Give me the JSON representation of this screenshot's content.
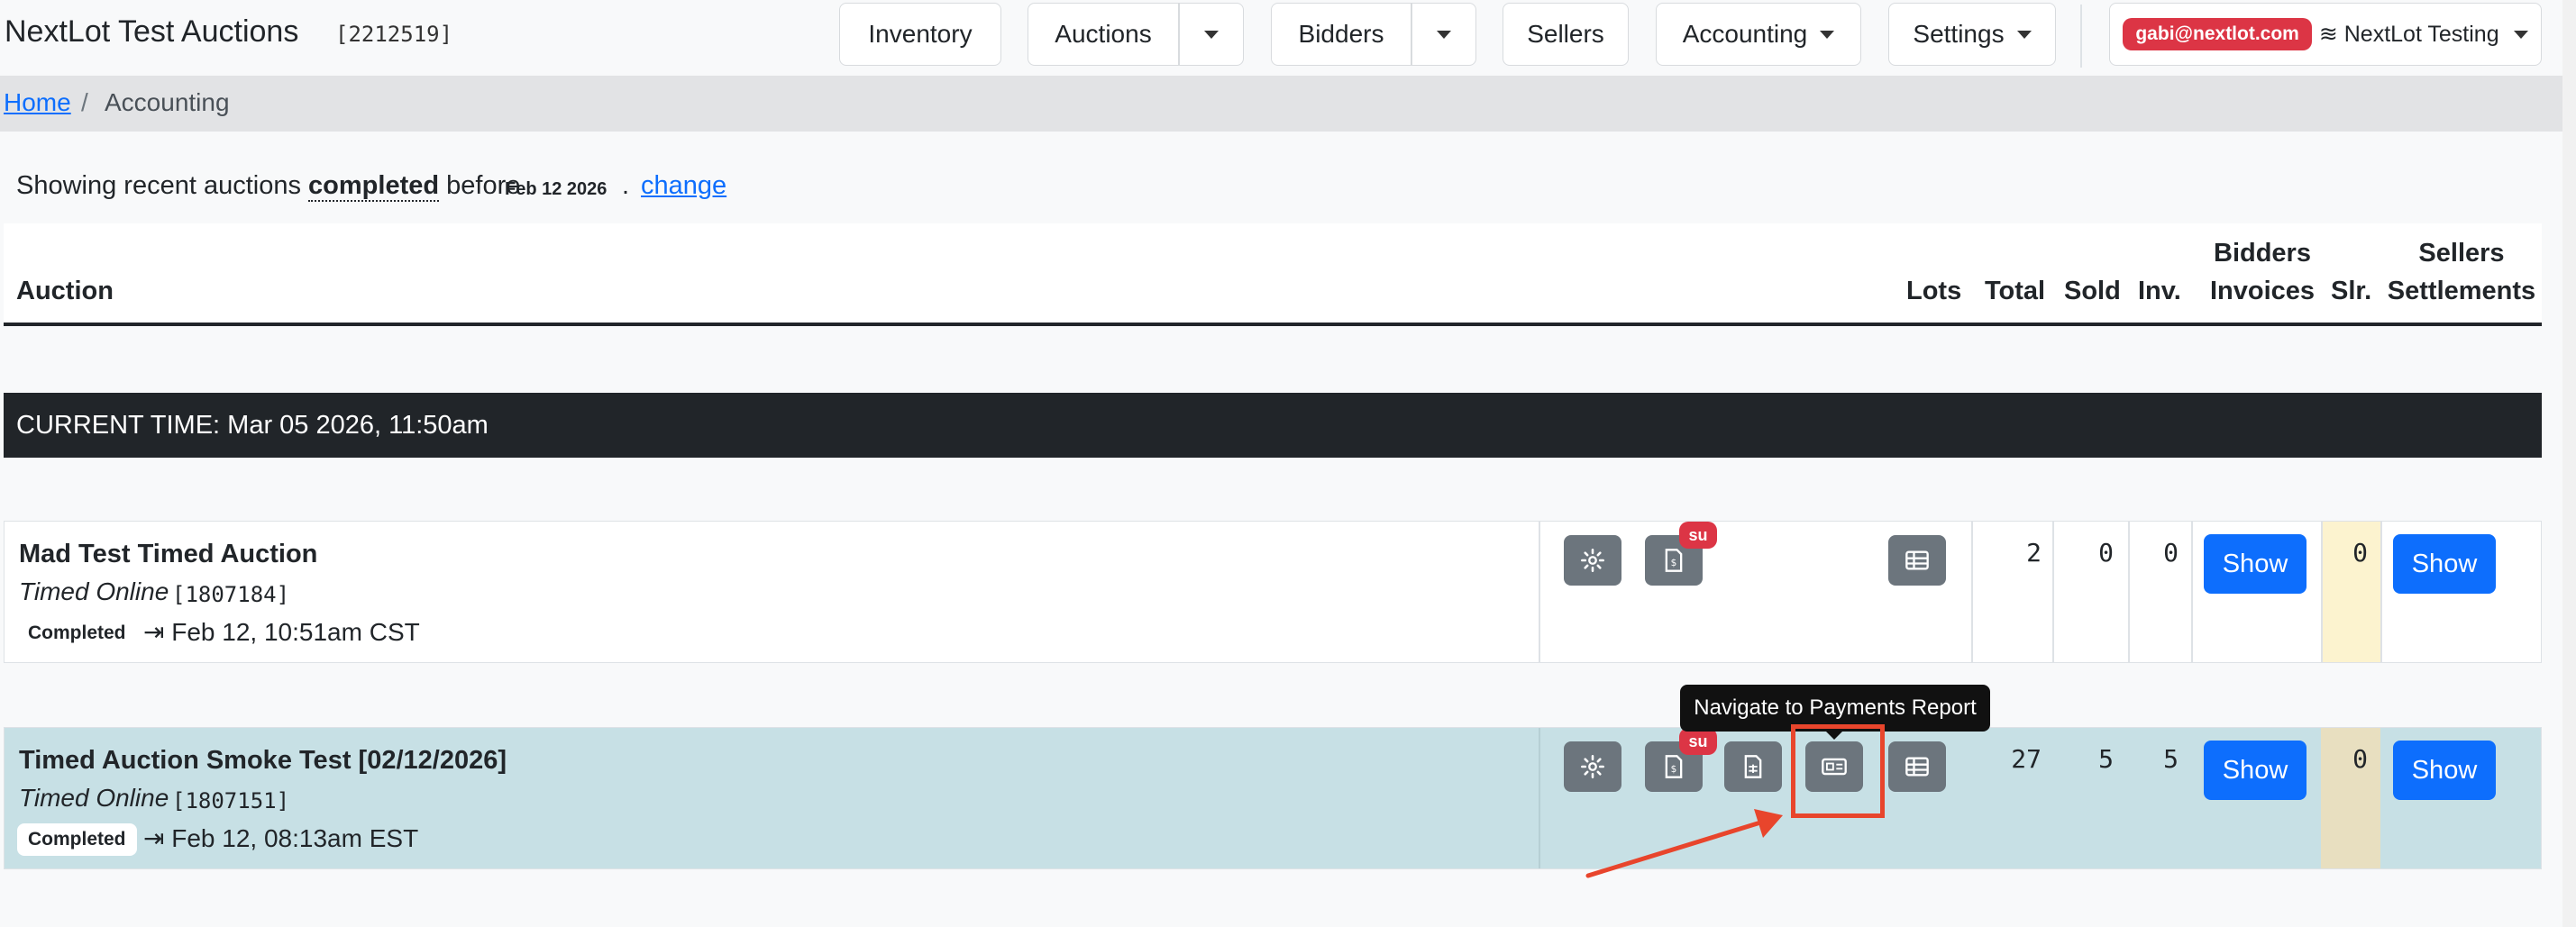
{
  "header": {
    "brand": "NextLot Test Auctions",
    "site_id": "[2212519]",
    "nav": {
      "inventory": "Inventory",
      "auctions": "Auctions",
      "bidders": "Bidders",
      "sellers": "Sellers",
      "accounting": "Accounting",
      "settings": "Settings"
    },
    "user_email": "gabi@nextlot.com",
    "user_site": "≋ NextLot Testing"
  },
  "breadcrumb": {
    "home": "Home",
    "separator": "/",
    "current": "Accounting"
  },
  "filter": {
    "prefix": "Showing recent auctions",
    "keyword": "completed",
    "middle": "before",
    "date": "Feb 12 2026",
    "dot": ".",
    "change": "change"
  },
  "table": {
    "headers": {
      "auction": "Auction",
      "lots": "Lots",
      "total": "Total",
      "sold": "Sold",
      "inv": "Inv.",
      "bidders_invoices_1": "Bidders",
      "bidders_invoices_2": "Invoices",
      "slr": "Slr.",
      "sellers_settlements_1": "Sellers",
      "sellers_settlements_2": "Settlements"
    },
    "current_time": "CURRENT TIME: Mar 05 2026, 11:50am",
    "rows": [
      {
        "title": "Mad Test Timed Auction",
        "type": "Timed Online",
        "id": "[1807184]",
        "status": "Completed",
        "when": "Feb 12, 10:51am CST",
        "su_badge": "su",
        "total": "2",
        "sold": "0",
        "inv": "0",
        "invoices_show": "Show",
        "slr": "0",
        "settlements_show": "Show"
      },
      {
        "title": "Timed Auction Smoke Test [02/12/2026]",
        "type": "Timed Online",
        "id": "[1807151]",
        "status": "Completed",
        "when": "Feb 12, 08:13am EST",
        "su_badge": "su",
        "total": "27",
        "sold": "5",
        "inv": "5",
        "invoices_show": "Show",
        "slr": "0",
        "settlements_show": "Show"
      }
    ]
  },
  "tooltip": "Navigate to Payments Report",
  "colors": {
    "primary": "#0d6efd",
    "danger": "#dc3545",
    "icon_button": "#6c757d",
    "highlight_row": "#c7e0e5",
    "slr_column": "#fcf3cf",
    "annotation": "#e8452c"
  }
}
